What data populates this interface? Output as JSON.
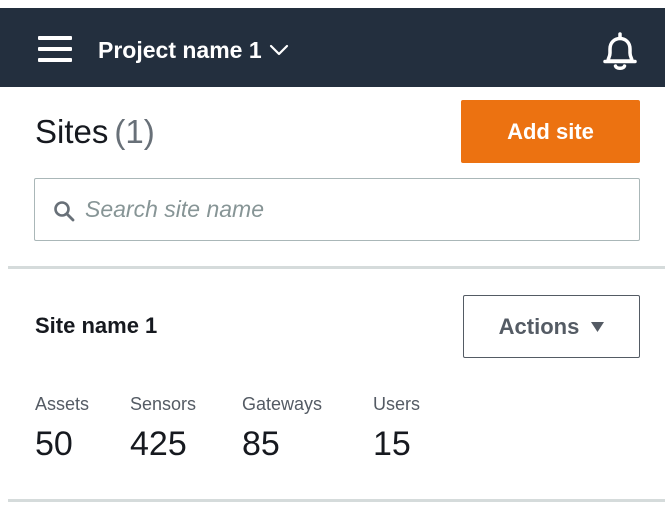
{
  "header": {
    "project_name": "Project name 1",
    "icons": [
      "menu-icon",
      "chevron-down-icon",
      "bell-icon"
    ]
  },
  "sites": {
    "title": "Sites",
    "count": "(1)",
    "add_label": "Add site"
  },
  "search": {
    "placeholder": "Search site name",
    "value": ""
  },
  "site": {
    "name": "Site name 1",
    "actions_label": "Actions",
    "stats": [
      {
        "label": "Assets",
        "value": "50"
      },
      {
        "label": "Sensors",
        "value": "425"
      },
      {
        "label": "Gateways",
        "value": "85"
      },
      {
        "label": "Users",
        "value": "15"
      }
    ]
  },
  "colors": {
    "topbar": "#232f3e",
    "accent": "#ec7211",
    "text": "#16191f",
    "muted": "#687078",
    "border": "#aab7b8",
    "divider": "#d5dbdb"
  }
}
